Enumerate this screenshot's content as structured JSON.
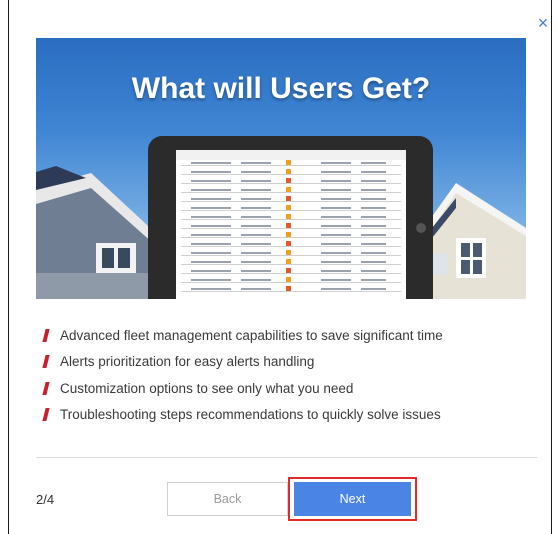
{
  "dialog": {
    "close_label": "×",
    "hero_title": "What will Users Get?",
    "features": [
      "Advanced fleet management capabilities to save significant time",
      "Alerts prioritization for easy alerts handling",
      "Customization options to see only what you need",
      "Troubleshooting steps recommendations to quickly solve issues"
    ],
    "page_indicator": "2/4",
    "back_label": "Back",
    "next_label": "Next"
  },
  "colors": {
    "accent": "#4a85e6",
    "bullet": "#c8202c",
    "highlight": "#e32a2a"
  }
}
